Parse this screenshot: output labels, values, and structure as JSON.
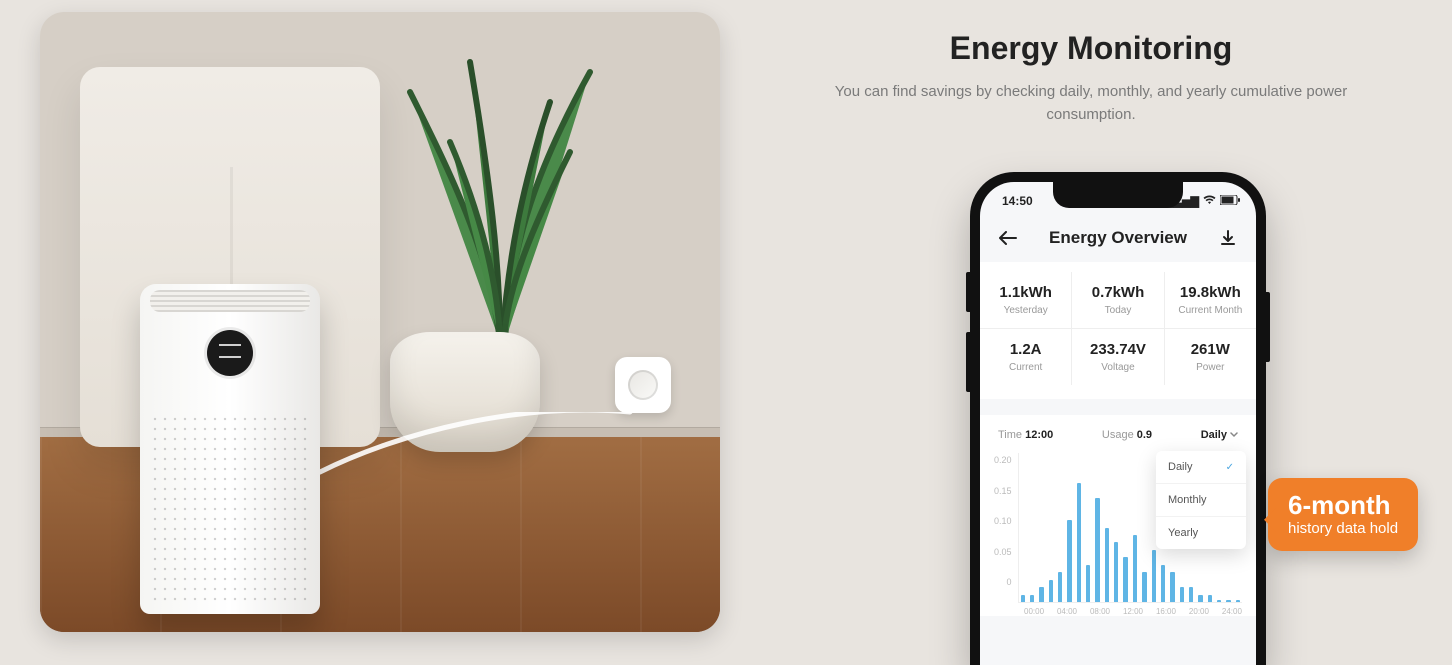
{
  "heading": {
    "title": "Energy Monitoring",
    "subtitle": "You can find savings by checking daily, monthly, and yearly cumulative power consumption."
  },
  "phone": {
    "time": "14:50",
    "app_title": "Energy Overview",
    "metrics": [
      {
        "value": "1.1kWh",
        "label": "Yesterday"
      },
      {
        "value": "0.7kWh",
        "label": "Today"
      },
      {
        "value": "19.8kWh",
        "label": "Current Month"
      },
      {
        "value": "1.2A",
        "label": "Current"
      },
      {
        "value": "233.74V",
        "label": "Voltage"
      },
      {
        "value": "261W",
        "label": "Power"
      }
    ],
    "chart_header": {
      "time_label": "Time",
      "time_value": "12:00",
      "usage_label": "Usage",
      "usage_value": "0.9",
      "dropdown_selected": "Daily"
    },
    "dropdown_options": [
      "Daily",
      "Monthly",
      "Yearly"
    ]
  },
  "callout": {
    "title": "6-month",
    "subtitle": "history data hold"
  },
  "chart_data": {
    "type": "bar",
    "title": "",
    "ylabel": "",
    "ylim": [
      0,
      0.2
    ],
    "y_ticks": [
      "0.20",
      "0.15",
      "0.10",
      "0.05",
      "0"
    ],
    "x_ticks": [
      "00:00",
      "04:00",
      "08:00",
      "12:00",
      "16:00",
      "20:00",
      "24:00"
    ],
    "categories": [
      "00",
      "01",
      "02",
      "03",
      "04",
      "05",
      "06",
      "07",
      "08",
      "09",
      "10",
      "11",
      "12",
      "13",
      "14",
      "15",
      "16",
      "17",
      "18",
      "19",
      "20",
      "21",
      "22",
      "23"
    ],
    "values": [
      0.01,
      0.01,
      0.02,
      0.03,
      0.04,
      0.11,
      0.16,
      0.05,
      0.14,
      0.1,
      0.08,
      0.06,
      0.09,
      0.04,
      0.07,
      0.05,
      0.04,
      0.02,
      0.02,
      0.01,
      0.01,
      0.0,
      0.0,
      0.0
    ]
  }
}
